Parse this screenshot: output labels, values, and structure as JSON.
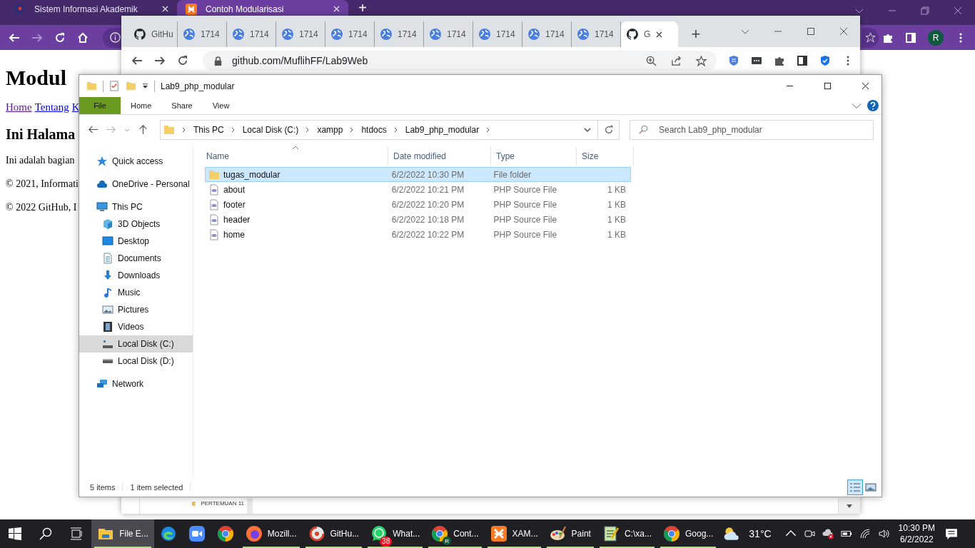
{
  "back_browser": {
    "tabs": [
      {
        "title": "Sistem Informasi Akademik",
        "kind": "campus",
        "selected": false
      },
      {
        "title": "Contoh Modularisasi",
        "kind": "xampp",
        "selected": true
      }
    ],
    "new_tab": "+",
    "profile": "R",
    "page": {
      "heading": "Modul",
      "links": [
        "Home",
        "Tentang",
        "K"
      ],
      "subheading": "Ini Halama",
      "paragraphs": [
        "Ini adalah bagian",
        "© 2021, Informati",
        "© 2022 GitHub, I"
      ]
    }
  },
  "front_browser": {
    "tabs": [
      {
        "title": "GitHu",
        "kind": "github",
        "selected": false
      },
      {
        "title": "1714",
        "kind": "globe",
        "selected": false
      },
      {
        "title": "1714",
        "kind": "globe",
        "selected": false
      },
      {
        "title": "1714",
        "kind": "globe",
        "selected": false
      },
      {
        "title": "1714",
        "kind": "globe",
        "selected": false
      },
      {
        "title": "1714",
        "kind": "globe",
        "selected": false
      },
      {
        "title": "1714",
        "kind": "globe",
        "selected": false
      },
      {
        "title": "1714",
        "kind": "globe",
        "selected": false
      },
      {
        "title": "1714",
        "kind": "globe",
        "selected": false
      },
      {
        "title": "1714",
        "kind": "globe",
        "selected": false
      },
      {
        "title": "G",
        "kind": "github",
        "selected": true
      }
    ],
    "new_tab": "+",
    "url": "github.com/MuflihFF/Lab9Web",
    "sidebar_item": "PERTEMUAN 11"
  },
  "explorer": {
    "title": "Lab9_php_modular",
    "ribbon_tabs": [
      {
        "label": "File",
        "selected": true
      },
      {
        "label": "Home",
        "selected": false
      },
      {
        "label": "Share",
        "selected": false
      },
      {
        "label": "View",
        "selected": false
      }
    ],
    "breadcrumb": [
      "This PC",
      "Local Disk (C:)",
      "xampp",
      "htdocs",
      "Lab9_php_modular"
    ],
    "search": {
      "placeholder": "Search Lab9_php_modular"
    },
    "nav": [
      {
        "label": "Quick access",
        "kind": "star",
        "selected": false
      },
      {
        "label": "OneDrive - Personal",
        "kind": "cloud",
        "selected": false
      },
      {
        "label": "This PC",
        "kind": "pc",
        "selected": false,
        "children": [
          {
            "label": "3D Objects",
            "kind": "cube",
            "selected": false
          },
          {
            "label": "Desktop",
            "kind": "desktop",
            "selected": false
          },
          {
            "label": "Documents",
            "kind": "document",
            "selected": false
          },
          {
            "label": "Downloads",
            "kind": "download",
            "selected": false
          },
          {
            "label": "Music",
            "kind": "music",
            "selected": false
          },
          {
            "label": "Pictures",
            "kind": "image",
            "selected": false
          },
          {
            "label": "Videos",
            "kind": "film",
            "selected": false
          },
          {
            "label": "Local Disk (C:)",
            "kind": "drive-c",
            "selected": true
          },
          {
            "label": "Local Disk (D:)",
            "kind": "drive",
            "selected": false
          }
        ]
      },
      {
        "label": "Network",
        "kind": "network",
        "selected": false
      }
    ],
    "columns": [
      "Name",
      "Date modified",
      "Type",
      "Size"
    ],
    "rows": [
      {
        "name": "tugas_modular",
        "date": "6/2/2022 10:30 PM",
        "type": "File folder",
        "size": "",
        "kind": "folder",
        "selected": true
      },
      {
        "name": "about",
        "date": "6/2/2022 10:21 PM",
        "type": "PHP Source File",
        "size": "1 KB",
        "kind": "php",
        "selected": false
      },
      {
        "name": "footer",
        "date": "6/2/2022 10:20 PM",
        "type": "PHP Source File",
        "size": "1 KB",
        "kind": "php",
        "selected": false
      },
      {
        "name": "header",
        "date": "6/2/2022 10:18 PM",
        "type": "PHP Source File",
        "size": "1 KB",
        "kind": "php",
        "selected": false
      },
      {
        "name": "home",
        "date": "6/2/2022 10:22 PM",
        "type": "PHP Source File",
        "size": "1 KB",
        "kind": "php",
        "selected": false
      }
    ],
    "status": [
      "5 items",
      "1 item selected"
    ],
    "views": [
      {
        "kind": "details",
        "selected": true
      },
      {
        "kind": "large-icons",
        "selected": false
      }
    ]
  },
  "taskbar": {
    "apps": [
      {
        "label": "File E...",
        "kind": "explorer",
        "running": true,
        "active": true
      },
      {
        "kind": "edge",
        "running": false,
        "active": false
      },
      {
        "kind": "zoom",
        "running": false,
        "active": false
      },
      {
        "kind": "chrome",
        "running": false,
        "active": false
      },
      {
        "label": "Mozill...",
        "kind": "firefox",
        "running": true,
        "active": false
      },
      {
        "label": "GitHu...",
        "kind": "github-desktop",
        "running": true,
        "active": false
      },
      {
        "label": "What...",
        "kind": "whatsapp",
        "badge": "38",
        "running": true,
        "active": false
      },
      {
        "label": "Cont...",
        "kind": "chrome",
        "profile": "R",
        "running": true,
        "active": false
      },
      {
        "label": "XAM...",
        "kind": "xampp",
        "running": true,
        "active": false
      },
      {
        "label": "Paint",
        "kind": "paint",
        "running": true,
        "active": false
      },
      {
        "label": "C:\\xa...",
        "kind": "notepad",
        "running": true,
        "active": false
      },
      {
        "label": "Goog...",
        "kind": "chrome",
        "running": true,
        "active": false
      }
    ],
    "temperature": "31°C",
    "time": "10:30 PM",
    "date": "6/2/2022"
  }
}
